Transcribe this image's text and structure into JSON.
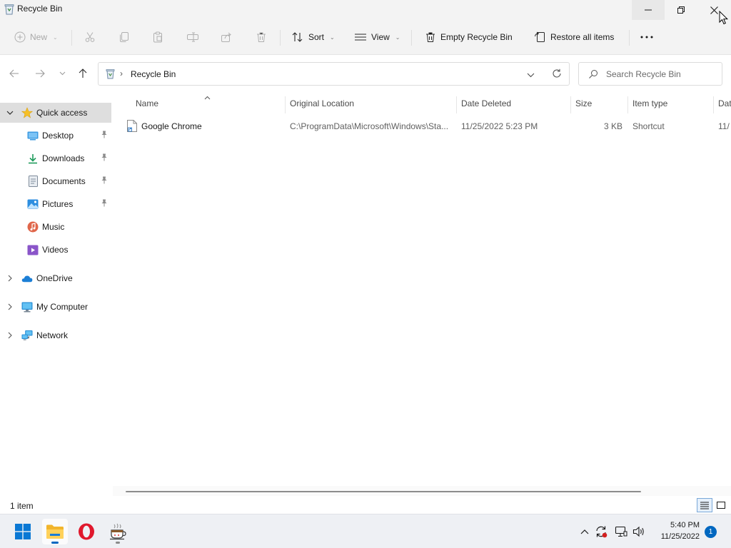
{
  "window": {
    "title": "Recycle Bin"
  },
  "toolbar": {
    "new_label": "New",
    "sort_label": "Sort",
    "view_label": "View",
    "empty_label": "Empty Recycle Bin",
    "restore_label": "Restore all items",
    "more_icon": "more-options-icon"
  },
  "address": {
    "crumb": "Recycle Bin"
  },
  "search": {
    "placeholder": "Search Recycle Bin"
  },
  "sidebar": {
    "items": [
      {
        "label": "Quick access",
        "icon": "star-icon",
        "expanded": true,
        "selected": true
      },
      {
        "label": "Desktop",
        "icon": "desktop-folder-icon",
        "pinned": true
      },
      {
        "label": "Downloads",
        "icon": "downloads-icon",
        "pinned": true
      },
      {
        "label": "Documents",
        "icon": "documents-icon",
        "pinned": true
      },
      {
        "label": "Pictures",
        "icon": "pictures-icon",
        "pinned": true
      },
      {
        "label": "Music",
        "icon": "music-icon",
        "pinned": false
      },
      {
        "label": "Videos",
        "icon": "videos-icon",
        "pinned": false
      },
      {
        "label": "OneDrive",
        "icon": "onedrive-icon",
        "expanded": false
      },
      {
        "label": "My Computer",
        "icon": "computer-icon",
        "expanded": false
      },
      {
        "label": "Network",
        "icon": "network-icon",
        "expanded": false
      }
    ]
  },
  "table": {
    "columns": [
      "Name",
      "Original Location",
      "Date Deleted",
      "Size",
      "Item type",
      "Dat"
    ],
    "rows": [
      {
        "name": "Google Chrome",
        "location": "C:\\ProgramData\\Microsoft\\Windows\\Sta...",
        "date_deleted": "11/25/2022 5:23 PM",
        "size": "3 KB",
        "type": "Shortcut",
        "extra": "11/"
      }
    ]
  },
  "status": {
    "count": "1 item"
  },
  "taskbar": {
    "apps": [
      "windows-start-icon",
      "file-explorer-icon",
      "opera-icon",
      "coffee-app-icon"
    ],
    "time": "5:40 PM",
    "date": "11/25/2022",
    "notifications": "1"
  },
  "colors": {
    "accent": "#0067c0",
    "selected_bg": "#dedede",
    "chrome_bg": "#f3f3f3"
  }
}
